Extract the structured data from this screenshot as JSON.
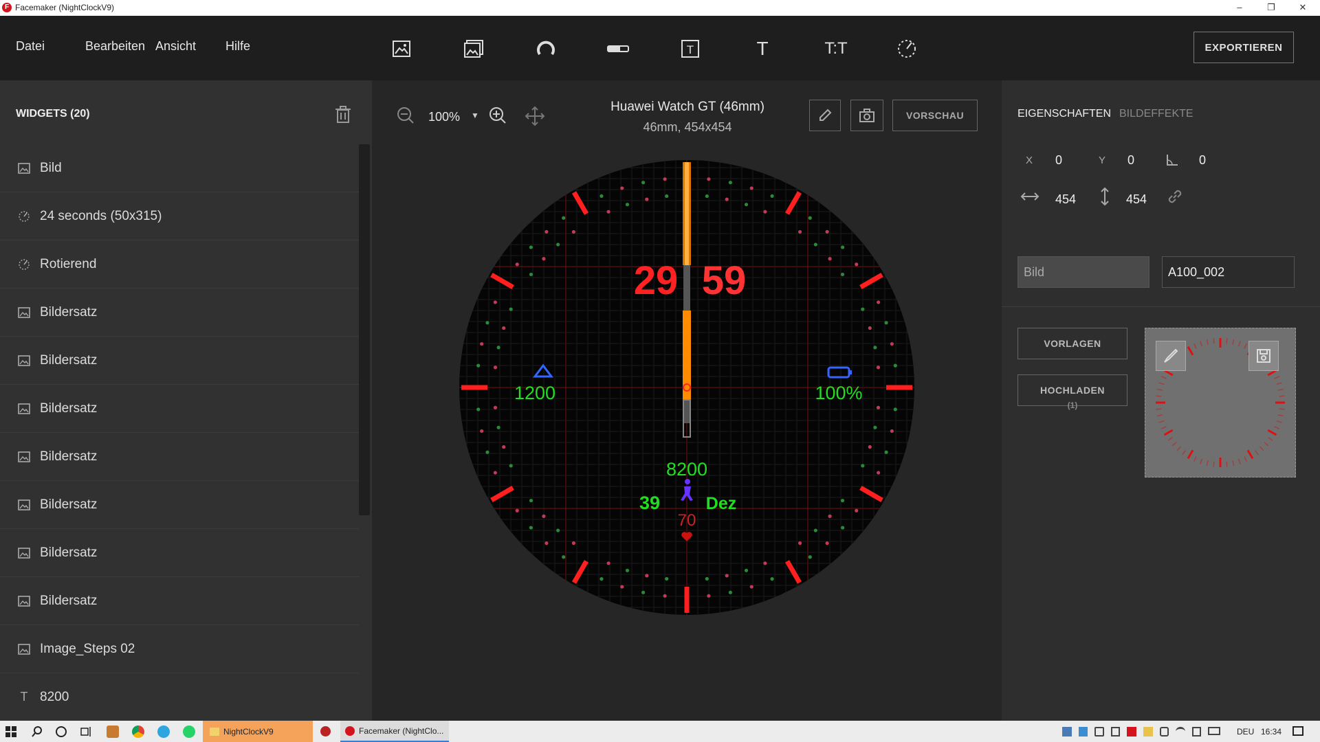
{
  "window": {
    "title": "Facemaker (NightClockV9)",
    "minimize": "–",
    "restore": "❐",
    "close": "✕"
  },
  "menu": {
    "file": "Datei",
    "edit": "Bearbeiten",
    "view": "Ansicht",
    "help": "Hilfe"
  },
  "toolbar": {
    "text_tool": "T",
    "text_pair_tool": "T:T",
    "export_label": "EXPORTIEREN"
  },
  "widgets": {
    "header": "WIDGETS (20)",
    "items": [
      {
        "label": "Bild",
        "icon": "image-icon"
      },
      {
        "label": "24 seconds (50x315)",
        "icon": "rotate-hand-icon"
      },
      {
        "label": "Rotierend",
        "icon": "rotate-hand-icon"
      },
      {
        "label": "Bildersatz",
        "icon": "image-icon"
      },
      {
        "label": "Bildersatz",
        "icon": "image-icon"
      },
      {
        "label": "Bildersatz",
        "icon": "image-icon"
      },
      {
        "label": "Bildersatz",
        "icon": "image-icon"
      },
      {
        "label": "Bildersatz",
        "icon": "image-icon"
      },
      {
        "label": "Bildersatz",
        "icon": "image-icon"
      },
      {
        "label": "Bildersatz",
        "icon": "image-icon"
      },
      {
        "label": "Image_Steps 02",
        "icon": "image-icon"
      },
      {
        "label": "8200",
        "icon": "text-icon",
        "glyph": "T"
      }
    ]
  },
  "canvas": {
    "zoom": "100%",
    "device_name": "Huawei Watch GT (46mm)",
    "device_spec": "46mm, 454x454",
    "preview_label": "VORSCHAU",
    "watch": {
      "hours": "29",
      "minutes": "59",
      "altitude": "1200",
      "battery": "100%",
      "steps": "8200",
      "day": "39",
      "month": "Dez",
      "heart_rate": "70"
    }
  },
  "properties": {
    "tab_properties": "EIGENSCHAFTEN",
    "tab_effects": "BILDEFFEKTE",
    "x_label": "X",
    "x": "0",
    "y_label": "Y",
    "y": "0",
    "rotation": "0",
    "width": "454",
    "height": "454",
    "type": "Bild",
    "image_name": "A100_002",
    "templates_label": "VORLAGEN",
    "upload_label": "HOCHLADEN",
    "upload_count": "(1)"
  },
  "taskbar": {
    "item1": "NightClockV9",
    "item2": "Facemaker (NightClo...",
    "lang": "DEU",
    "time": "16:34"
  },
  "colors": {
    "accent_red": "#ff2222",
    "watch_green": "#22dd22",
    "hand_orange": "#ff8c00",
    "icon_blue": "#3366ff"
  }
}
